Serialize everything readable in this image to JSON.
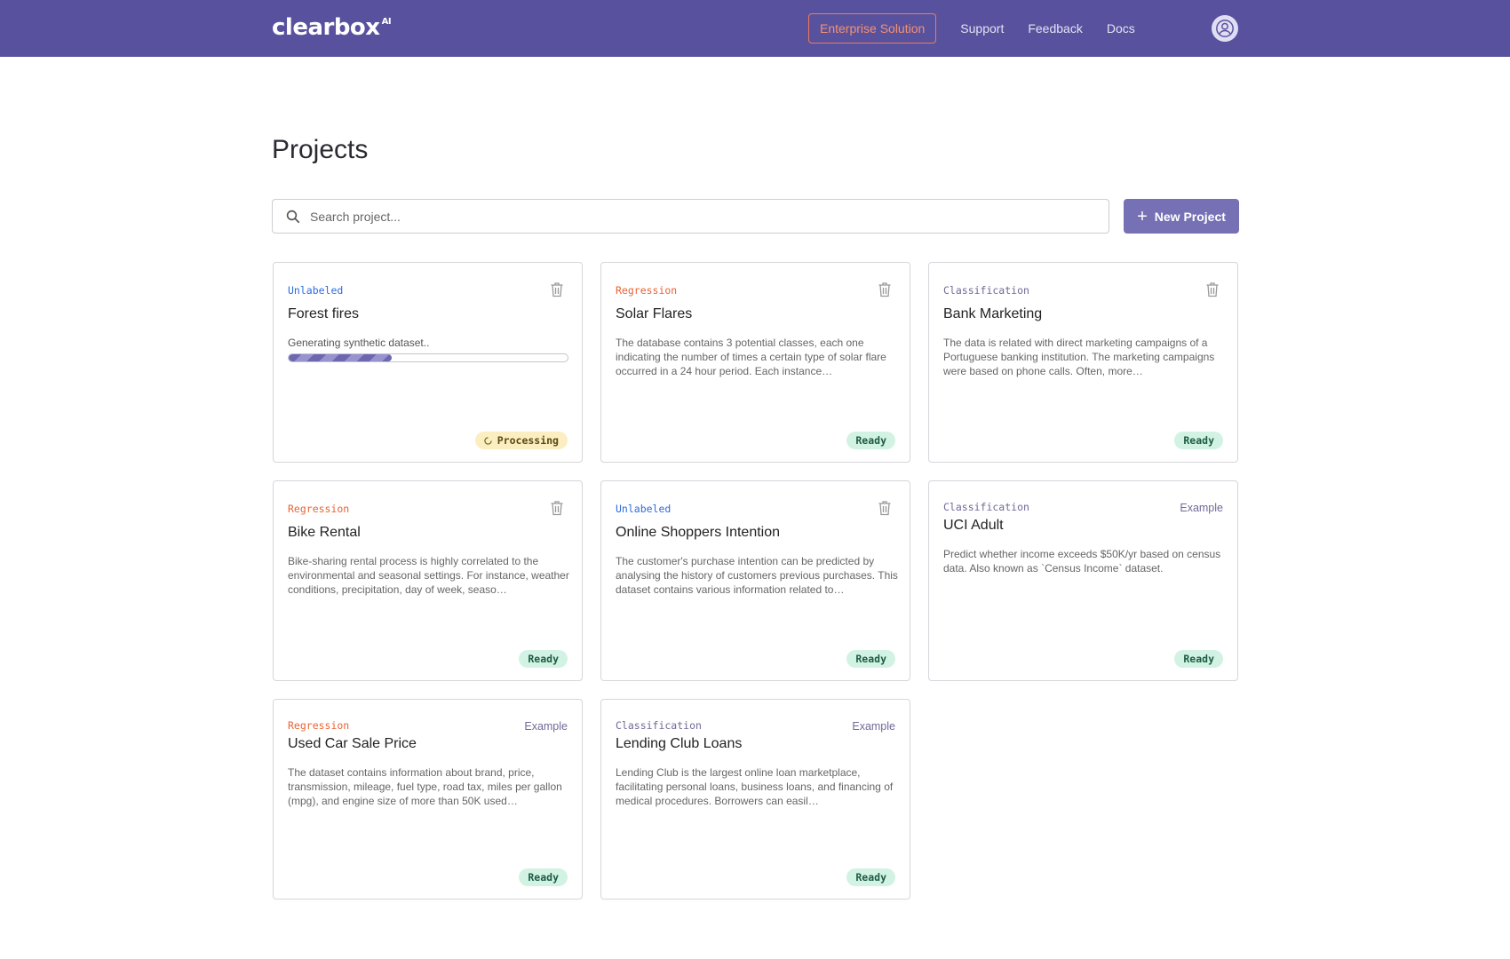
{
  "header": {
    "logo": "clearbox",
    "logo_suffix": "AI",
    "nav": {
      "enterprise": "Enterprise Solution",
      "support": "Support",
      "feedback": "Feedback",
      "docs": "Docs"
    },
    "brand_color": "#58529e",
    "accent_color": "#f07a59"
  },
  "main": {
    "title": "Projects",
    "search": {
      "placeholder": "Search project...",
      "value": ""
    },
    "new_project_label": "New Project"
  },
  "status_colors": {
    "ready": "#d2f3e4",
    "processing": "#fbeec0"
  },
  "cards": [
    {
      "tag": "Unlabeled",
      "title": "Forest fires",
      "progress_text": "Generating synthetic dataset..",
      "progress": 0.37,
      "status": "Processing",
      "icon": "trash-icon"
    },
    {
      "tag": "Regression",
      "title": "Solar Flares",
      "description": "The database contains 3 potential classes, each one indicating the number of times a certain type of solar flare occurred in a 24 hour period. Each instance…",
      "status": "Ready",
      "icon": "trash-icon"
    },
    {
      "tag": "Classification",
      "title": "Bank Marketing",
      "description": "The data is related with direct marketing campaigns of a Portuguese banking institution. The marketing campaigns were based on phone calls. Often, more…",
      "status": "Ready",
      "icon": "trash-icon"
    },
    {
      "tag": "Regression",
      "title": "Bike Rental",
      "description": "Bike-sharing rental process is highly correlated to the environmental and seasonal settings. For instance, weather conditions, precipitation, day of week, seaso…",
      "status": "Ready",
      "icon": "trash-icon"
    },
    {
      "tag": "Unlabeled",
      "title": "Online Shoppers Intention",
      "description": "The customer's purchase intention can be predicted by analysing the history of customers previous purchases. This dataset contains various information related to…",
      "status": "Ready",
      "icon": "trash-icon"
    },
    {
      "tag": "Classification",
      "title": "UCI Adult",
      "example_label": "Example",
      "description": "Predict whether income exceeds $50K/yr based on census data. Also known as `Census Income` dataset.",
      "status": "Ready"
    },
    {
      "tag": "Regression",
      "title": "Used Car Sale Price",
      "example_label": "Example",
      "description": "The dataset contains information about brand, price, transmission, mileage, fuel type, road tax, miles per gallon (mpg), and engine size of more than 50K used…",
      "status": "Ready"
    },
    {
      "tag": "Classification",
      "title": "Lending Club Loans",
      "example_label": "Example",
      "description": "Lending Club is the largest online loan marketplace, facilitating personal loans, business loans, and financing of medical procedures. Borrowers can easil…",
      "status": "Ready"
    }
  ]
}
